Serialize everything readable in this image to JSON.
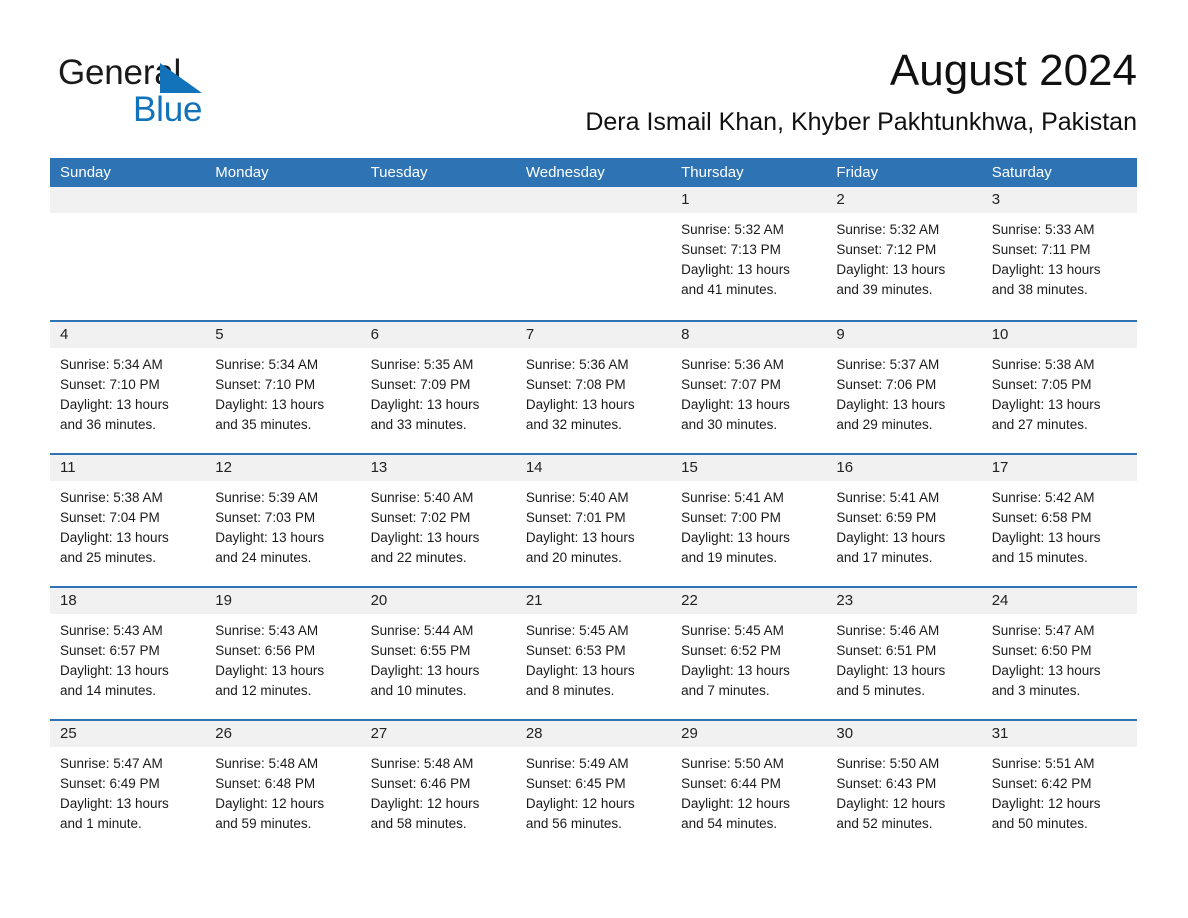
{
  "brand": {
    "line1": "General",
    "line2": "Blue",
    "triangle_color": "#1273bb"
  },
  "header": {
    "title": "August 2024",
    "subtitle": "Dera Ismail Khan, Khyber Pakhtunkhwa, Pakistan"
  },
  "colors": {
    "accent": "#2e74b5",
    "brand_blue": "#1273bb",
    "day_band": "#f1f1f1",
    "text": "#1a1a1a"
  },
  "weekdays": [
    "Sunday",
    "Monday",
    "Tuesday",
    "Wednesday",
    "Thursday",
    "Friday",
    "Saturday"
  ],
  "weeks": [
    [
      {
        "day": ""
      },
      {
        "day": ""
      },
      {
        "day": ""
      },
      {
        "day": ""
      },
      {
        "day": "1",
        "sunrise": "Sunrise: 5:32 AM",
        "sunset": "Sunset: 7:13 PM",
        "daylight1": "Daylight: 13 hours",
        "daylight2": "and 41 minutes."
      },
      {
        "day": "2",
        "sunrise": "Sunrise: 5:32 AM",
        "sunset": "Sunset: 7:12 PM",
        "daylight1": "Daylight: 13 hours",
        "daylight2": "and 39 minutes."
      },
      {
        "day": "3",
        "sunrise": "Sunrise: 5:33 AM",
        "sunset": "Sunset: 7:11 PM",
        "daylight1": "Daylight: 13 hours",
        "daylight2": "and 38 minutes."
      }
    ],
    [
      {
        "day": "4",
        "sunrise": "Sunrise: 5:34 AM",
        "sunset": "Sunset: 7:10 PM",
        "daylight1": "Daylight: 13 hours",
        "daylight2": "and 36 minutes."
      },
      {
        "day": "5",
        "sunrise": "Sunrise: 5:34 AM",
        "sunset": "Sunset: 7:10 PM",
        "daylight1": "Daylight: 13 hours",
        "daylight2": "and 35 minutes."
      },
      {
        "day": "6",
        "sunrise": "Sunrise: 5:35 AM",
        "sunset": "Sunset: 7:09 PM",
        "daylight1": "Daylight: 13 hours",
        "daylight2": "and 33 minutes."
      },
      {
        "day": "7",
        "sunrise": "Sunrise: 5:36 AM",
        "sunset": "Sunset: 7:08 PM",
        "daylight1": "Daylight: 13 hours",
        "daylight2": "and 32 minutes."
      },
      {
        "day": "8",
        "sunrise": "Sunrise: 5:36 AM",
        "sunset": "Sunset: 7:07 PM",
        "daylight1": "Daylight: 13 hours",
        "daylight2": "and 30 minutes."
      },
      {
        "day": "9",
        "sunrise": "Sunrise: 5:37 AM",
        "sunset": "Sunset: 7:06 PM",
        "daylight1": "Daylight: 13 hours",
        "daylight2": "and 29 minutes."
      },
      {
        "day": "10",
        "sunrise": "Sunrise: 5:38 AM",
        "sunset": "Sunset: 7:05 PM",
        "daylight1": "Daylight: 13 hours",
        "daylight2": "and 27 minutes."
      }
    ],
    [
      {
        "day": "11",
        "sunrise": "Sunrise: 5:38 AM",
        "sunset": "Sunset: 7:04 PM",
        "daylight1": "Daylight: 13 hours",
        "daylight2": "and 25 minutes."
      },
      {
        "day": "12",
        "sunrise": "Sunrise: 5:39 AM",
        "sunset": "Sunset: 7:03 PM",
        "daylight1": "Daylight: 13 hours",
        "daylight2": "and 24 minutes."
      },
      {
        "day": "13",
        "sunrise": "Sunrise: 5:40 AM",
        "sunset": "Sunset: 7:02 PM",
        "daylight1": "Daylight: 13 hours",
        "daylight2": "and 22 minutes."
      },
      {
        "day": "14",
        "sunrise": "Sunrise: 5:40 AM",
        "sunset": "Sunset: 7:01 PM",
        "daylight1": "Daylight: 13 hours",
        "daylight2": "and 20 minutes."
      },
      {
        "day": "15",
        "sunrise": "Sunrise: 5:41 AM",
        "sunset": "Sunset: 7:00 PM",
        "daylight1": "Daylight: 13 hours",
        "daylight2": "and 19 minutes."
      },
      {
        "day": "16",
        "sunrise": "Sunrise: 5:41 AM",
        "sunset": "Sunset: 6:59 PM",
        "daylight1": "Daylight: 13 hours",
        "daylight2": "and 17 minutes."
      },
      {
        "day": "17",
        "sunrise": "Sunrise: 5:42 AM",
        "sunset": "Sunset: 6:58 PM",
        "daylight1": "Daylight: 13 hours",
        "daylight2": "and 15 minutes."
      }
    ],
    [
      {
        "day": "18",
        "sunrise": "Sunrise: 5:43 AM",
        "sunset": "Sunset: 6:57 PM",
        "daylight1": "Daylight: 13 hours",
        "daylight2": "and 14 minutes."
      },
      {
        "day": "19",
        "sunrise": "Sunrise: 5:43 AM",
        "sunset": "Sunset: 6:56 PM",
        "daylight1": "Daylight: 13 hours",
        "daylight2": "and 12 minutes."
      },
      {
        "day": "20",
        "sunrise": "Sunrise: 5:44 AM",
        "sunset": "Sunset: 6:55 PM",
        "daylight1": "Daylight: 13 hours",
        "daylight2": "and 10 minutes."
      },
      {
        "day": "21",
        "sunrise": "Sunrise: 5:45 AM",
        "sunset": "Sunset: 6:53 PM",
        "daylight1": "Daylight: 13 hours",
        "daylight2": "and 8 minutes."
      },
      {
        "day": "22",
        "sunrise": "Sunrise: 5:45 AM",
        "sunset": "Sunset: 6:52 PM",
        "daylight1": "Daylight: 13 hours",
        "daylight2": "and 7 minutes."
      },
      {
        "day": "23",
        "sunrise": "Sunrise: 5:46 AM",
        "sunset": "Sunset: 6:51 PM",
        "daylight1": "Daylight: 13 hours",
        "daylight2": "and 5 minutes."
      },
      {
        "day": "24",
        "sunrise": "Sunrise: 5:47 AM",
        "sunset": "Sunset: 6:50 PM",
        "daylight1": "Daylight: 13 hours",
        "daylight2": "and 3 minutes."
      }
    ],
    [
      {
        "day": "25",
        "sunrise": "Sunrise: 5:47 AM",
        "sunset": "Sunset: 6:49 PM",
        "daylight1": "Daylight: 13 hours",
        "daylight2": "and 1 minute."
      },
      {
        "day": "26",
        "sunrise": "Sunrise: 5:48 AM",
        "sunset": "Sunset: 6:48 PM",
        "daylight1": "Daylight: 12 hours",
        "daylight2": "and 59 minutes."
      },
      {
        "day": "27",
        "sunrise": "Sunrise: 5:48 AM",
        "sunset": "Sunset: 6:46 PM",
        "daylight1": "Daylight: 12 hours",
        "daylight2": "and 58 minutes."
      },
      {
        "day": "28",
        "sunrise": "Sunrise: 5:49 AM",
        "sunset": "Sunset: 6:45 PM",
        "daylight1": "Daylight: 12 hours",
        "daylight2": "and 56 minutes."
      },
      {
        "day": "29",
        "sunrise": "Sunrise: 5:50 AM",
        "sunset": "Sunset: 6:44 PM",
        "daylight1": "Daylight: 12 hours",
        "daylight2": "and 54 minutes."
      },
      {
        "day": "30",
        "sunrise": "Sunrise: 5:50 AM",
        "sunset": "Sunset: 6:43 PM",
        "daylight1": "Daylight: 12 hours",
        "daylight2": "and 52 minutes."
      },
      {
        "day": "31",
        "sunrise": "Sunrise: 5:51 AM",
        "sunset": "Sunset: 6:42 PM",
        "daylight1": "Daylight: 12 hours",
        "daylight2": "and 50 minutes."
      }
    ]
  ]
}
